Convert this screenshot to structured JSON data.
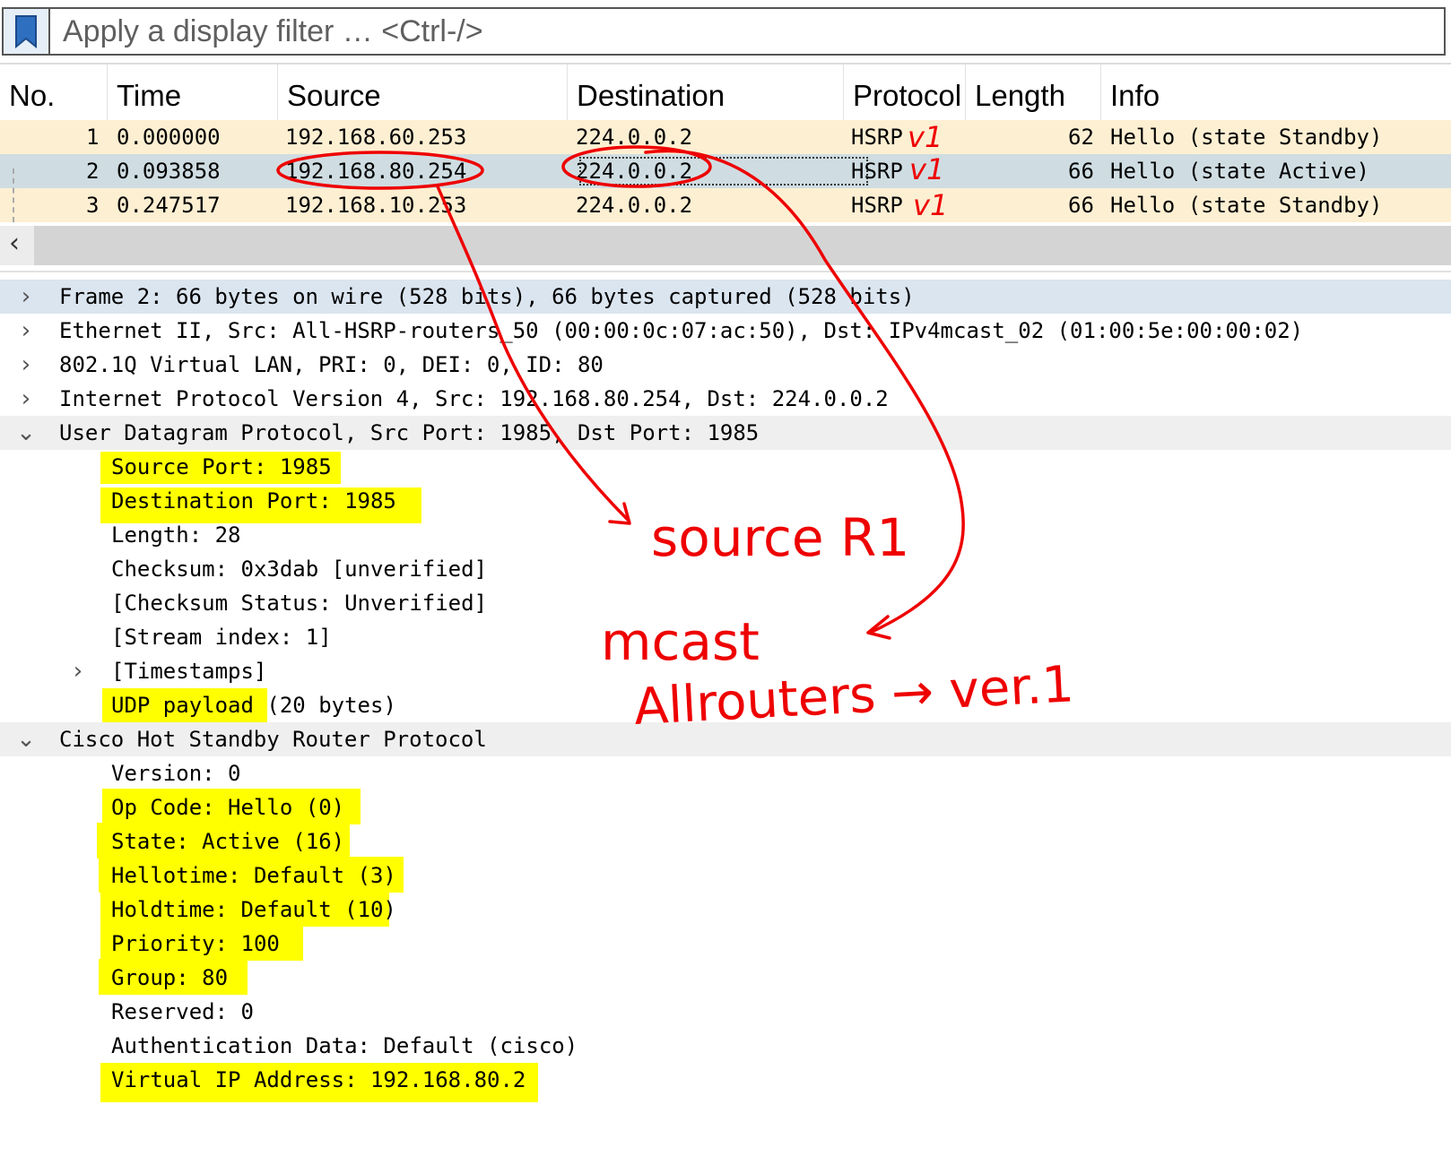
{
  "filter": {
    "placeholder": "Apply a display filter … <Ctrl-/>"
  },
  "packet_list": {
    "headers": {
      "no": "No.",
      "time": "Time",
      "source": "Source",
      "destination": "Destination",
      "protocol": "Protocol",
      "length": "Length",
      "info": "Info"
    },
    "rows": [
      {
        "no": "1",
        "time": "0.000000",
        "source": "192.168.60.253",
        "destination": "224.0.0.2",
        "protocol": "HSRP",
        "length": "62",
        "info": "Hello (state Standby)"
      },
      {
        "no": "2",
        "time": "0.093858",
        "source": "192.168.80.254",
        "destination": "224.0.0.2",
        "protocol": "HSRP",
        "length": "66",
        "info": "Hello (state Active)"
      },
      {
        "no": "3",
        "time": "0.247517",
        "source": "192.168.10.253",
        "destination": "224.0.0.2",
        "protocol": "HSRP",
        "length": "66",
        "info": "Hello (state Standby)"
      }
    ]
  },
  "details": {
    "frame": "Frame 2: 66 bytes on wire (528 bits), 66 bytes captured (528 bits)",
    "ethernet": "Ethernet II, Src: All-HSRP-routers_50 (00:00:0c:07:ac:50), Dst: IPv4mcast_02 (01:00:5e:00:00:02)",
    "vlan": "802.1Q Virtual LAN, PRI: 0, DEI: 0, ID: 80",
    "ipv4": "Internet Protocol Version 4, Src: 192.168.80.254, Dst: 224.0.0.2",
    "udp": "User Datagram Protocol, Src Port: 1985, Dst Port: 1985",
    "udp_fields": {
      "src_port": "Source Port: 1985",
      "dst_port": "Destination Port: 1985",
      "length": "Length: 28",
      "checksum": "Checksum: 0x3dab [unverified]",
      "checksum_status": "[Checksum Status: Unverified]",
      "stream_index": "[Stream index: 1]",
      "timestamps": "[Timestamps]",
      "payload_label": "UDP payload",
      "payload_rest": " (20 bytes)"
    },
    "hsrp": "Cisco Hot Standby Router Protocol",
    "hsrp_fields": {
      "version": "Version: 0",
      "op_code": "Op Code: Hello (0)",
      "state": "State: Active (16)",
      "hellotime": "Hellotime: Default (3)",
      "holdtime": "Holdtime: Default (10)",
      "priority": "Priority: 100",
      "group": "Group: 80",
      "reserved": "Reserved: 0",
      "auth": "Authentication Data: Default (cisco)",
      "vip": "Virtual IP Address: 192.168.80.2"
    }
  },
  "annotations": {
    "v1_marks": [
      "v1",
      "v1",
      "v1"
    ],
    "source_note": "source R1",
    "mcast_note": "mcast",
    "allrouters_note": "Allrouters → ver.1"
  },
  "colors": {
    "hsrp_row": "#fdefd2",
    "selected_row": "#cfdde2",
    "highlight": "#ffff00",
    "annotation": "#ee0000"
  }
}
